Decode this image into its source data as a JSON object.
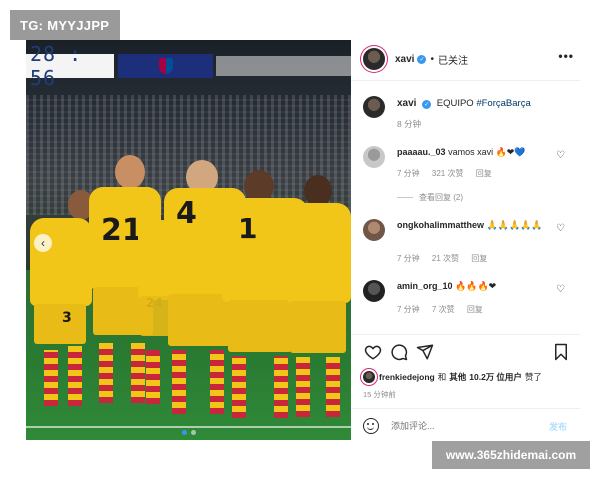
{
  "watermarks": {
    "top_left": "TG: MYYJJPP",
    "bottom_right": "www.365zhidemai.com"
  },
  "photo": {
    "scoreboard": "28 : 56",
    "jersey_numbers": [
      "21",
      "4",
      "1",
      "3",
      "24"
    ],
    "carousel_dots": 2,
    "active_dot": 0
  },
  "post": {
    "header": {
      "username": "xavi",
      "separator": "•",
      "follow_label": "已关注",
      "more_label": "•••"
    },
    "caption": {
      "username": "xavi",
      "text": "EQUIPO",
      "hashtag": "#ForçaBarça",
      "time": "8 分钟"
    },
    "comments": [
      {
        "username": "paaaau._03",
        "text": "vamos xavi",
        "emojis": "🔥❤💙",
        "time": "7 分钟",
        "likes": "321 次赞",
        "reply": "回复",
        "view_replies": "查看回复 (2)"
      },
      {
        "username": "ongkohalimmatthew",
        "text": "",
        "emojis": "🙏🙏🙏🙏🙏",
        "time": "7 分钟",
        "likes": "21 次赞",
        "reply": "回复",
        "view_replies": ""
      },
      {
        "username": "amin_org_10",
        "text": "",
        "emojis": "🔥🔥🔥❤",
        "time": "7 分钟",
        "likes": "7 次赞",
        "reply": "回复",
        "view_replies": ""
      }
    ],
    "likes": {
      "first_user": "frenkiedejong",
      "and": "和",
      "others_label": "其他",
      "count": "10.2万",
      "users_label": "位用户",
      "liked": "赞了"
    },
    "post_time": "15 分钟前",
    "comment_input": {
      "placeholder": "添加评论...",
      "post_label": "发布"
    }
  },
  "colors": {
    "verified": "#3897f0",
    "hashtag": "#00376b",
    "barca_yellow": "#f2c619",
    "barca_red": "#c8263b",
    "post_button": "#b2dffc"
  },
  "icons": [
    "more-icon",
    "heart-icon",
    "comment-icon",
    "share-icon",
    "bookmark-icon",
    "emoji-icon",
    "verified-icon",
    "carousel-arrow-icon"
  ]
}
